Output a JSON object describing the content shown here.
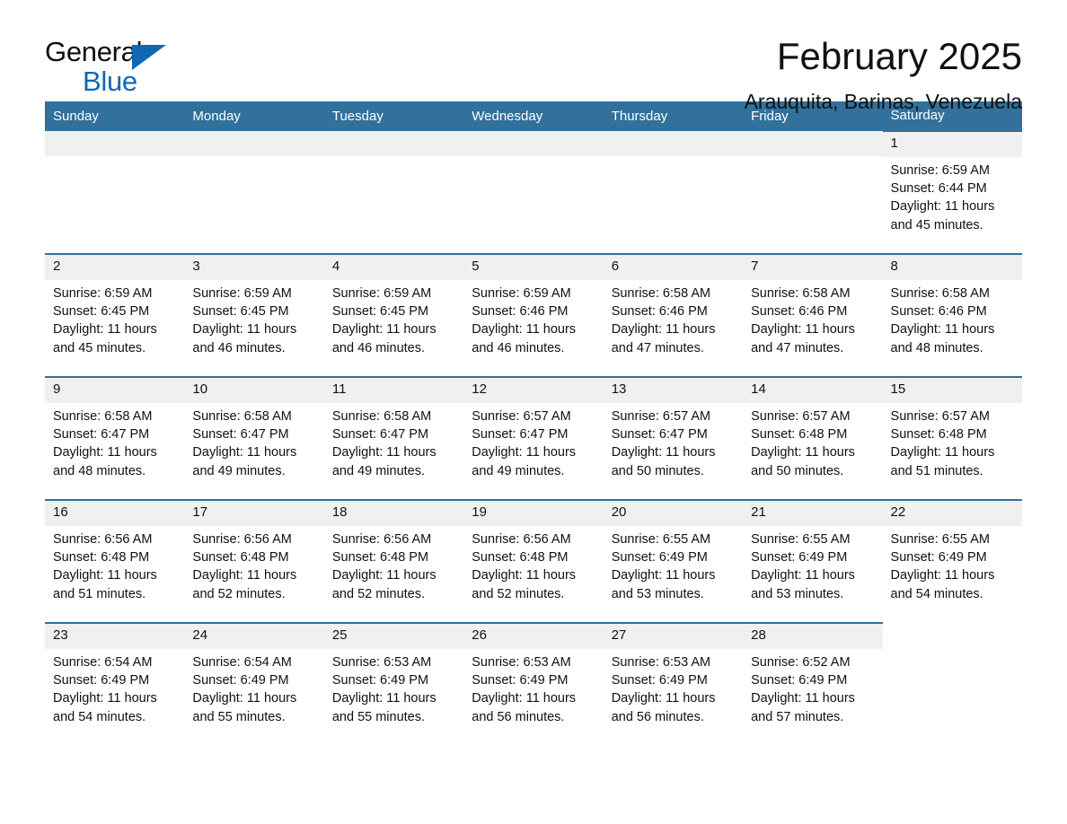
{
  "brand": {
    "name_top": "General",
    "name_bottom": "Blue",
    "accent_color": "#1068b3"
  },
  "header": {
    "title": "February 2025",
    "location": "Arauquita, Barinas, Venezuela"
  },
  "theme": {
    "header_row_bg": "#31719b",
    "header_row_text": "#ffffff",
    "day_number_bg": "#f0f0f0",
    "row_divider": "#31719b",
    "page_bg": "#ffffff"
  },
  "calendar": {
    "weekdays": [
      "Sunday",
      "Monday",
      "Tuesday",
      "Wednesday",
      "Thursday",
      "Friday",
      "Saturday"
    ],
    "weeks": [
      [
        {
          "day": "",
          "blank": true
        },
        {
          "day": "",
          "blank": true
        },
        {
          "day": "",
          "blank": true
        },
        {
          "day": "",
          "blank": true
        },
        {
          "day": "",
          "blank": true
        },
        {
          "day": "",
          "blank": true
        },
        {
          "day": "1",
          "sunrise": "Sunrise: 6:59 AM",
          "sunset": "Sunset: 6:44 PM",
          "daylight1": "Daylight: 11 hours",
          "daylight2": "and 45 minutes."
        }
      ],
      [
        {
          "day": "2",
          "sunrise": "Sunrise: 6:59 AM",
          "sunset": "Sunset: 6:45 PM",
          "daylight1": "Daylight: 11 hours",
          "daylight2": "and 45 minutes."
        },
        {
          "day": "3",
          "sunrise": "Sunrise: 6:59 AM",
          "sunset": "Sunset: 6:45 PM",
          "daylight1": "Daylight: 11 hours",
          "daylight2": "and 46 minutes."
        },
        {
          "day": "4",
          "sunrise": "Sunrise: 6:59 AM",
          "sunset": "Sunset: 6:45 PM",
          "daylight1": "Daylight: 11 hours",
          "daylight2": "and 46 minutes."
        },
        {
          "day": "5",
          "sunrise": "Sunrise: 6:59 AM",
          "sunset": "Sunset: 6:46 PM",
          "daylight1": "Daylight: 11 hours",
          "daylight2": "and 46 minutes."
        },
        {
          "day": "6",
          "sunrise": "Sunrise: 6:58 AM",
          "sunset": "Sunset: 6:46 PM",
          "daylight1": "Daylight: 11 hours",
          "daylight2": "and 47 minutes."
        },
        {
          "day": "7",
          "sunrise": "Sunrise: 6:58 AM",
          "sunset": "Sunset: 6:46 PM",
          "daylight1": "Daylight: 11 hours",
          "daylight2": "and 47 minutes."
        },
        {
          "day": "8",
          "sunrise": "Sunrise: 6:58 AM",
          "sunset": "Sunset: 6:46 PM",
          "daylight1": "Daylight: 11 hours",
          "daylight2": "and 48 minutes."
        }
      ],
      [
        {
          "day": "9",
          "sunrise": "Sunrise: 6:58 AM",
          "sunset": "Sunset: 6:47 PM",
          "daylight1": "Daylight: 11 hours",
          "daylight2": "and 48 minutes."
        },
        {
          "day": "10",
          "sunrise": "Sunrise: 6:58 AM",
          "sunset": "Sunset: 6:47 PM",
          "daylight1": "Daylight: 11 hours",
          "daylight2": "and 49 minutes."
        },
        {
          "day": "11",
          "sunrise": "Sunrise: 6:58 AM",
          "sunset": "Sunset: 6:47 PM",
          "daylight1": "Daylight: 11 hours",
          "daylight2": "and 49 minutes."
        },
        {
          "day": "12",
          "sunrise": "Sunrise: 6:57 AM",
          "sunset": "Sunset: 6:47 PM",
          "daylight1": "Daylight: 11 hours",
          "daylight2": "and 49 minutes."
        },
        {
          "day": "13",
          "sunrise": "Sunrise: 6:57 AM",
          "sunset": "Sunset: 6:47 PM",
          "daylight1": "Daylight: 11 hours",
          "daylight2": "and 50 minutes."
        },
        {
          "day": "14",
          "sunrise": "Sunrise: 6:57 AM",
          "sunset": "Sunset: 6:48 PM",
          "daylight1": "Daylight: 11 hours",
          "daylight2": "and 50 minutes."
        },
        {
          "day": "15",
          "sunrise": "Sunrise: 6:57 AM",
          "sunset": "Sunset: 6:48 PM",
          "daylight1": "Daylight: 11 hours",
          "daylight2": "and 51 minutes."
        }
      ],
      [
        {
          "day": "16",
          "sunrise": "Sunrise: 6:56 AM",
          "sunset": "Sunset: 6:48 PM",
          "daylight1": "Daylight: 11 hours",
          "daylight2": "and 51 minutes."
        },
        {
          "day": "17",
          "sunrise": "Sunrise: 6:56 AM",
          "sunset": "Sunset: 6:48 PM",
          "daylight1": "Daylight: 11 hours",
          "daylight2": "and 52 minutes."
        },
        {
          "day": "18",
          "sunrise": "Sunrise: 6:56 AM",
          "sunset": "Sunset: 6:48 PM",
          "daylight1": "Daylight: 11 hours",
          "daylight2": "and 52 minutes."
        },
        {
          "day": "19",
          "sunrise": "Sunrise: 6:56 AM",
          "sunset": "Sunset: 6:48 PM",
          "daylight1": "Daylight: 11 hours",
          "daylight2": "and 52 minutes."
        },
        {
          "day": "20",
          "sunrise": "Sunrise: 6:55 AM",
          "sunset": "Sunset: 6:49 PM",
          "daylight1": "Daylight: 11 hours",
          "daylight2": "and 53 minutes."
        },
        {
          "day": "21",
          "sunrise": "Sunrise: 6:55 AM",
          "sunset": "Sunset: 6:49 PM",
          "daylight1": "Daylight: 11 hours",
          "daylight2": "and 53 minutes."
        },
        {
          "day": "22",
          "sunrise": "Sunrise: 6:55 AM",
          "sunset": "Sunset: 6:49 PM",
          "daylight1": "Daylight: 11 hours",
          "daylight2": "and 54 minutes."
        }
      ],
      [
        {
          "day": "23",
          "sunrise": "Sunrise: 6:54 AM",
          "sunset": "Sunset: 6:49 PM",
          "daylight1": "Daylight: 11 hours",
          "daylight2": "and 54 minutes."
        },
        {
          "day": "24",
          "sunrise": "Sunrise: 6:54 AM",
          "sunset": "Sunset: 6:49 PM",
          "daylight1": "Daylight: 11 hours",
          "daylight2": "and 55 minutes."
        },
        {
          "day": "25",
          "sunrise": "Sunrise: 6:53 AM",
          "sunset": "Sunset: 6:49 PM",
          "daylight1": "Daylight: 11 hours",
          "daylight2": "and 55 minutes."
        },
        {
          "day": "26",
          "sunrise": "Sunrise: 6:53 AM",
          "sunset": "Sunset: 6:49 PM",
          "daylight1": "Daylight: 11 hours",
          "daylight2": "and 56 minutes."
        },
        {
          "day": "27",
          "sunrise": "Sunrise: 6:53 AM",
          "sunset": "Sunset: 6:49 PM",
          "daylight1": "Daylight: 11 hours",
          "daylight2": "and 56 minutes."
        },
        {
          "day": "28",
          "sunrise": "Sunrise: 6:52 AM",
          "sunset": "Sunset: 6:49 PM",
          "daylight1": "Daylight: 11 hours",
          "daylight2": "and 57 minutes."
        },
        {
          "day": "",
          "blank": true
        }
      ]
    ]
  }
}
